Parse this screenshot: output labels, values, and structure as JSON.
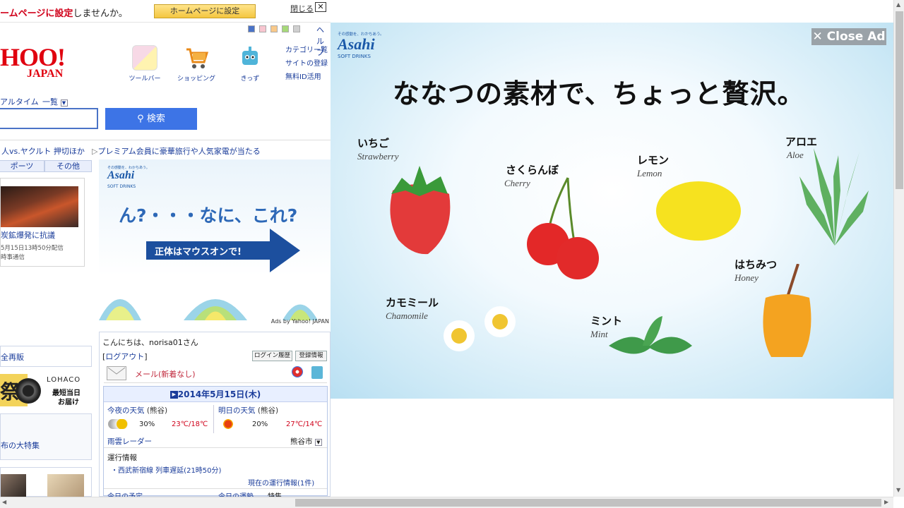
{
  "topbar": {
    "promo_plain": "ームページに",
    "promo_bold": "設定",
    "promo_tail": "しませんか。",
    "hp_button": "ホームページに設定",
    "close": "閉じる",
    "close_x": "✕",
    "help": "ヘルプ"
  },
  "logo": {
    "main": "HOO!",
    "sub": "JAPAN"
  },
  "services": [
    {
      "label": "ツールバー"
    },
    {
      "label": "ショッピング"
    },
    {
      "label": "きっず"
    }
  ],
  "right_links": [
    "カテゴリー覧",
    "サイトの登録",
    "無料ID活用"
  ],
  "search": {
    "realtime": "アルタイム",
    "list": "一覧",
    "button": "検索"
  },
  "ticker": {
    "left": "人vs.ヤクルト 押切ほか",
    "right": "プレミアム会員に豪華旅行や人気家電が当たる"
  },
  "tabs": [
    "ポーツ",
    "その他"
  ],
  "news": {
    "title": "炭鉱爆発に抗議",
    "meta1": "5月15日13時50分配信",
    "meta2": "時事通信"
  },
  "left_links": {
    "reprint": "全再販",
    "lohaco": "LOHACO",
    "lohaco_sub1": "最短当日",
    "lohaco_sub2": "お届け",
    "fest": "祭",
    "feature": "布の大特集"
  },
  "ad_small": {
    "tag": "その感動を、わかちあう。",
    "brand": "Asahi",
    "brand_sub": "SOFT DRINKS",
    "question": "ん?・・・なに、これ?",
    "cta": "正体はマウスオンで!",
    "credit": "Ads by Yahoo! JAPAN"
  },
  "user": {
    "greeting": "こんにちは、norisa01さん",
    "logout": "ログアウト",
    "btn_login_history": "ログイン履歴",
    "btn_reg_info": "登録情報",
    "mail": "メール(新着なし)"
  },
  "weather": {
    "date": "2014年5月15日(木)",
    "tonight_label": "今夜の天気",
    "tomorrow_label": "明日の天気",
    "city": "(熊谷)",
    "tonight_rain": "30%",
    "tonight_temp": "23℃/18℃",
    "tomorrow_rain": "20%",
    "tomorrow_temp": "27℃/14℃",
    "radar": "雨雲レーダー",
    "city_select": "熊谷市",
    "transit_label": "運行情報",
    "transit_item": "・西武新宿線 列車遅延(21時50分)",
    "transit_now": "現在の運行情報(1件)",
    "today1": "今日の予定",
    "today2": "今日の運勢",
    "today3": "特集"
  },
  "ad_big": {
    "close": "Close Ad",
    "tag": "その感動を、わかちあう。",
    "brand": "Asahi",
    "brand_sub": "SOFT DRINKS",
    "headline": "ななつの素材で、ちょっと贅沢。",
    "items": [
      {
        "jp": "いちご",
        "en": "Strawberry"
      },
      {
        "jp": "さくらんぼ",
        "en": "Cherry"
      },
      {
        "jp": "レモン",
        "en": "Lemon"
      },
      {
        "jp": "アロエ",
        "en": "Aloe"
      },
      {
        "jp": "はちみつ",
        "en": "Honey"
      },
      {
        "jp": "カモミール",
        "en": "Chamomile"
      },
      {
        "jp": "ミント",
        "en": "Mint"
      }
    ]
  },
  "colors": {
    "yahoo_red": "#e0000f",
    "link_blue": "#1a3c9a",
    "search_blue": "#3d74e6",
    "asahi_blue": "#1a58a8"
  }
}
